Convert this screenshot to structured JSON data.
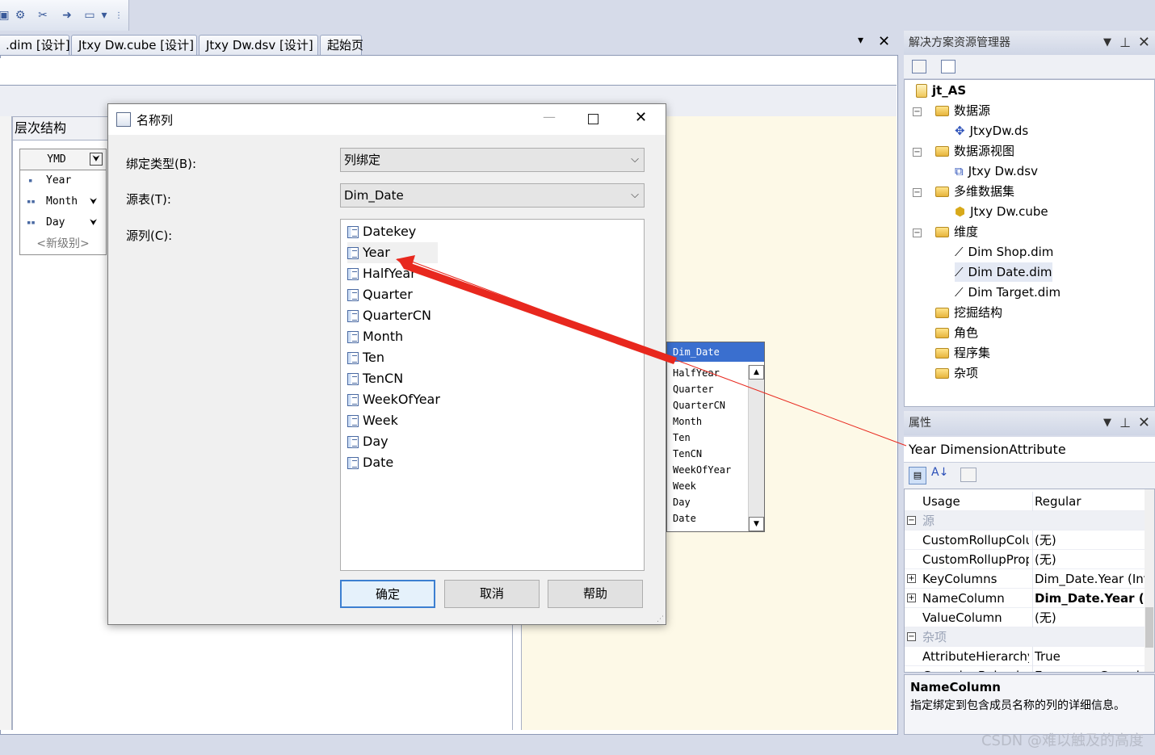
{
  "toolbar": {
    "icons": [
      "layout-icon",
      "properties-icon",
      "tools-icon",
      "import-icon",
      "window-icon",
      "dropdown-icon",
      "overflow-icon"
    ]
  },
  "tabs": [
    {
      "label": ".dim [设计]"
    },
    {
      "label": "Jtxy Dw.cube [设计]"
    },
    {
      "label": "Jtxy Dw.dsv [设计]"
    },
    {
      "label": "起始页"
    }
  ],
  "tab_controls": {
    "dropdown": "▾",
    "close": "✕"
  },
  "hierarchy": {
    "header": "层次结构",
    "title": "YMD",
    "levels": [
      "Year",
      "Month",
      "Day"
    ],
    "new_level": "<新级别>"
  },
  "dsv_table": {
    "name": "Dim_Date",
    "columns": [
      "HalfYear",
      "Quarter",
      "QuarterCN",
      "Month",
      "Ten",
      "TenCN",
      "WeekOfYear",
      "Week",
      "Day",
      "Date"
    ]
  },
  "dialog": {
    "title": "名称列",
    "binding_type_label": "绑定类型(B):",
    "binding_type_value": "列绑定",
    "source_table_label": "源表(T):",
    "source_table_value": "Dim_Date",
    "source_column_label": "源列(C):",
    "columns": [
      "Datekey",
      "Year",
      "HalfYear",
      "Quarter",
      "QuarterCN",
      "Month",
      "Ten",
      "TenCN",
      "WeekOfYear",
      "Week",
      "Day",
      "Date"
    ],
    "selected_column": "Year",
    "ok": "确定",
    "cancel": "取消",
    "help": "帮助"
  },
  "solution_explorer": {
    "title": "解决方案资源管理器",
    "project": "jt_AS",
    "items": [
      {
        "label": "数据源",
        "kind": "folder"
      },
      {
        "label": "JtxyDw.ds",
        "kind": "datasource"
      },
      {
        "label": "数据源视图",
        "kind": "folder"
      },
      {
        "label": "Jtxy Dw.dsv",
        "kind": "dsv"
      },
      {
        "label": "多维数据集",
        "kind": "folder"
      },
      {
        "label": "Jtxy Dw.cube",
        "kind": "cube"
      },
      {
        "label": "维度",
        "kind": "folder"
      },
      {
        "label": "Dim Shop.dim",
        "kind": "dimension"
      },
      {
        "label": "Dim Date.dim",
        "kind": "dimension"
      },
      {
        "label": "Dim Target.dim",
        "kind": "dimension"
      },
      {
        "label": "挖掘结构",
        "kind": "folder"
      },
      {
        "label": "角色",
        "kind": "folder"
      },
      {
        "label": "程序集",
        "kind": "folder"
      },
      {
        "label": "杂项",
        "kind": "folder"
      }
    ]
  },
  "properties": {
    "title": "属性",
    "object": "Year DimensionAttribute",
    "rows": [
      {
        "name": "Usage",
        "value": "Regular"
      },
      {
        "name": "源",
        "value": "",
        "category": true
      },
      {
        "name": "CustomRollupColu",
        "value": "(无)"
      },
      {
        "name": "CustomRollupProp",
        "value": "(无)"
      },
      {
        "name": "KeyColumns",
        "value": "Dim_Date.Year (Inte"
      },
      {
        "name": "NameColumn",
        "value": "Dim_Date.Year (W"
      },
      {
        "name": "ValueColumn",
        "value": "(无)"
      },
      {
        "name": "杂项",
        "value": "",
        "category": true
      },
      {
        "name": "AttributeHierarchy",
        "value": "True"
      },
      {
        "name": "GroupingBehavior",
        "value": "EncourageGroupin"
      }
    ],
    "description_title": "NameColumn",
    "description": "指定绑定到包含成员名称的列的详细信息。"
  },
  "watermark": "CSDN @难以触及的高度",
  "colors": {
    "accent": "#3a6fcf",
    "arrow": "#e8281e",
    "dsv_background": "#fdf9e7"
  }
}
